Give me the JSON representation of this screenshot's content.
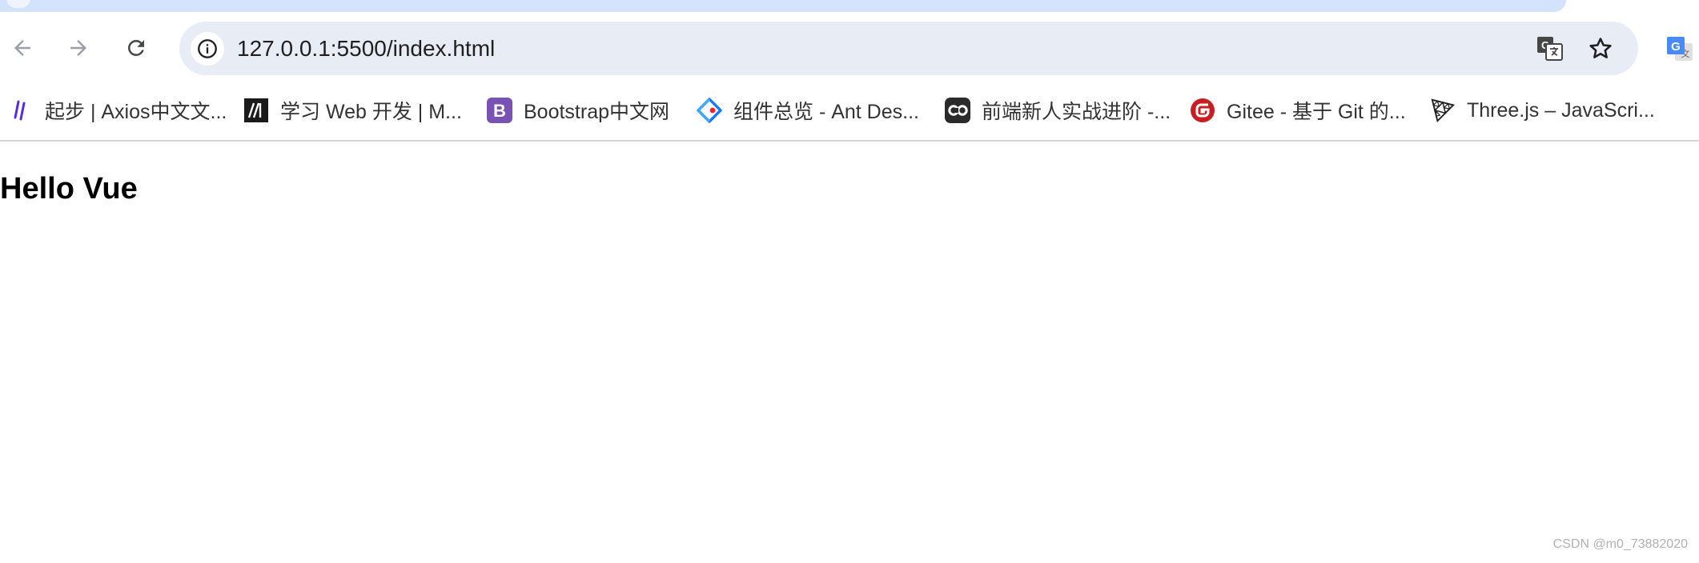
{
  "toolbar": {
    "url": "127.0.0.1:5500/index.html"
  },
  "bookmarks": [
    {
      "label": "起步 | Axios中文文...",
      "icon": "axios-icon"
    },
    {
      "label": "学习 Web 开发 | M...",
      "icon": "mdn-icon"
    },
    {
      "label": "Bootstrap中文网",
      "icon": "bootstrap-icon"
    },
    {
      "label": "组件总览 - Ant Des...",
      "icon": "ant-design-icon"
    },
    {
      "label": "前端新人实战进阶 -...",
      "icon": "co-icon"
    },
    {
      "label": "Gitee - 基于 Git 的...",
      "icon": "gitee-icon"
    },
    {
      "label": "Three.js – JavaScri...",
      "icon": "threejs-icon"
    }
  ],
  "page": {
    "heading": "Hello Vue",
    "watermark": "CSDN @m0_73882020"
  },
  "colors": {
    "tabstrip": "#d3e3fd",
    "omnibox": "#e8ecf5",
    "bootstrap": "#7952b3",
    "gitee": "#c71d23",
    "ant": "#1677ff"
  }
}
